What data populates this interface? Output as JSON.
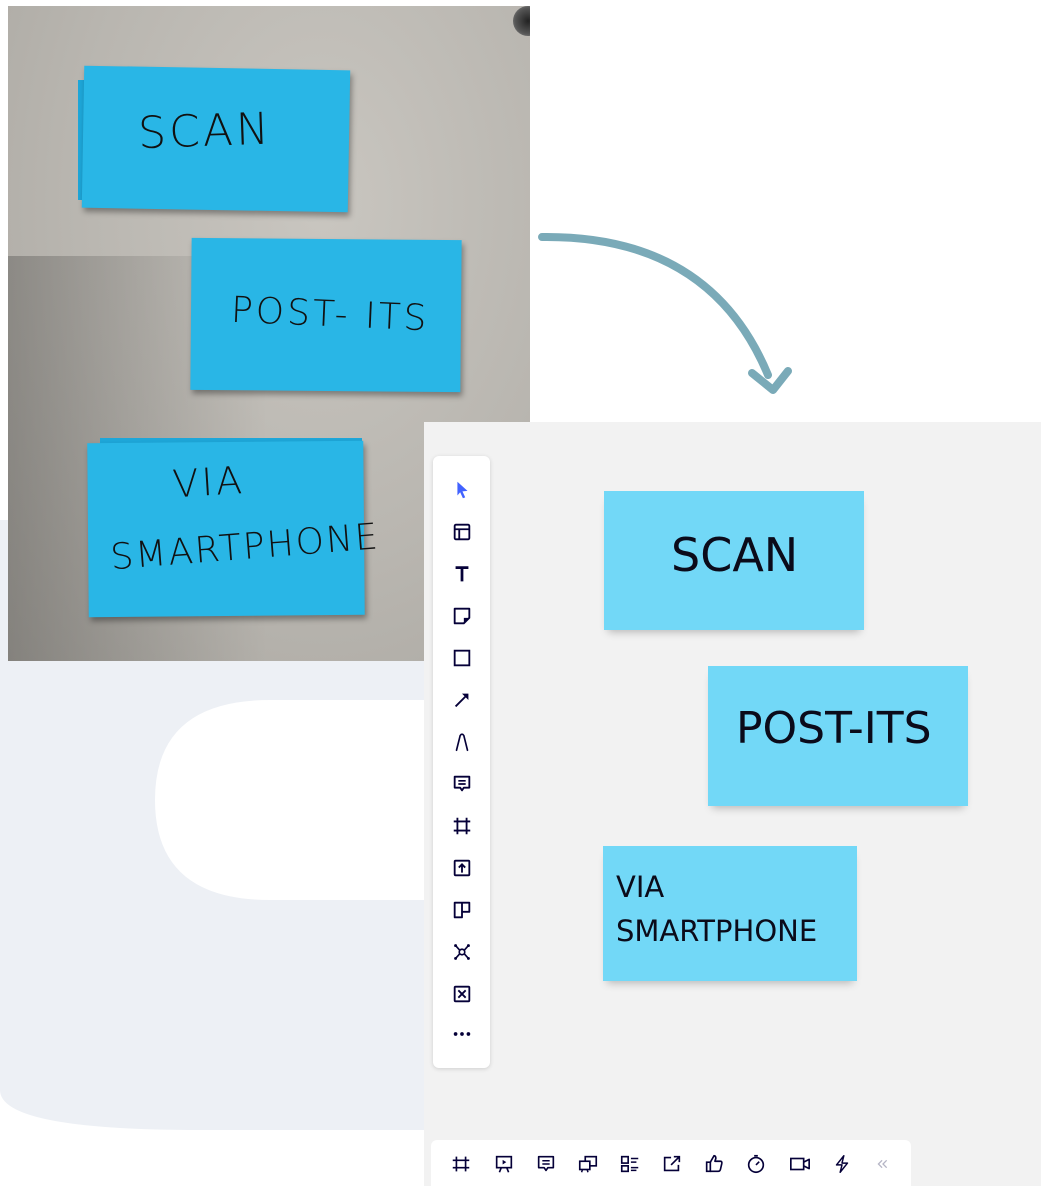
{
  "photo": {
    "notes": [
      "SCAN",
      "POST- ITS",
      "VIA",
      "SMARTPHONE"
    ]
  },
  "board": {
    "notes": {
      "scan": "SCAN",
      "postits": "POST-ITS",
      "via_line1": "VIA",
      "via_line2": "SMARTPHONE"
    },
    "note_color": "#72d8f7"
  },
  "toolbar": {
    "tools": [
      "select-cursor-icon",
      "templates-icon",
      "text-icon",
      "sticky-note-icon",
      "shape-icon",
      "connection-line-icon",
      "pen-icon",
      "comment-icon",
      "frame-icon",
      "upload-icon",
      "card-icon",
      "mind-map-icon",
      "embed-icon",
      "more-icon"
    ]
  },
  "bottom_toolbar": {
    "tools": [
      "frames-icon",
      "presentation-icon",
      "comments-icon",
      "share-screen-icon",
      "cards-list-icon",
      "export-icon",
      "reactions-icon",
      "timer-icon",
      "video-call-icon",
      "integrations-icon",
      "collapse-icon"
    ]
  },
  "colors": {
    "accent": "#4262ff",
    "arrow": "#7aaab8",
    "paper": "#29b6e6",
    "board_bg": "#f2f2f2"
  }
}
